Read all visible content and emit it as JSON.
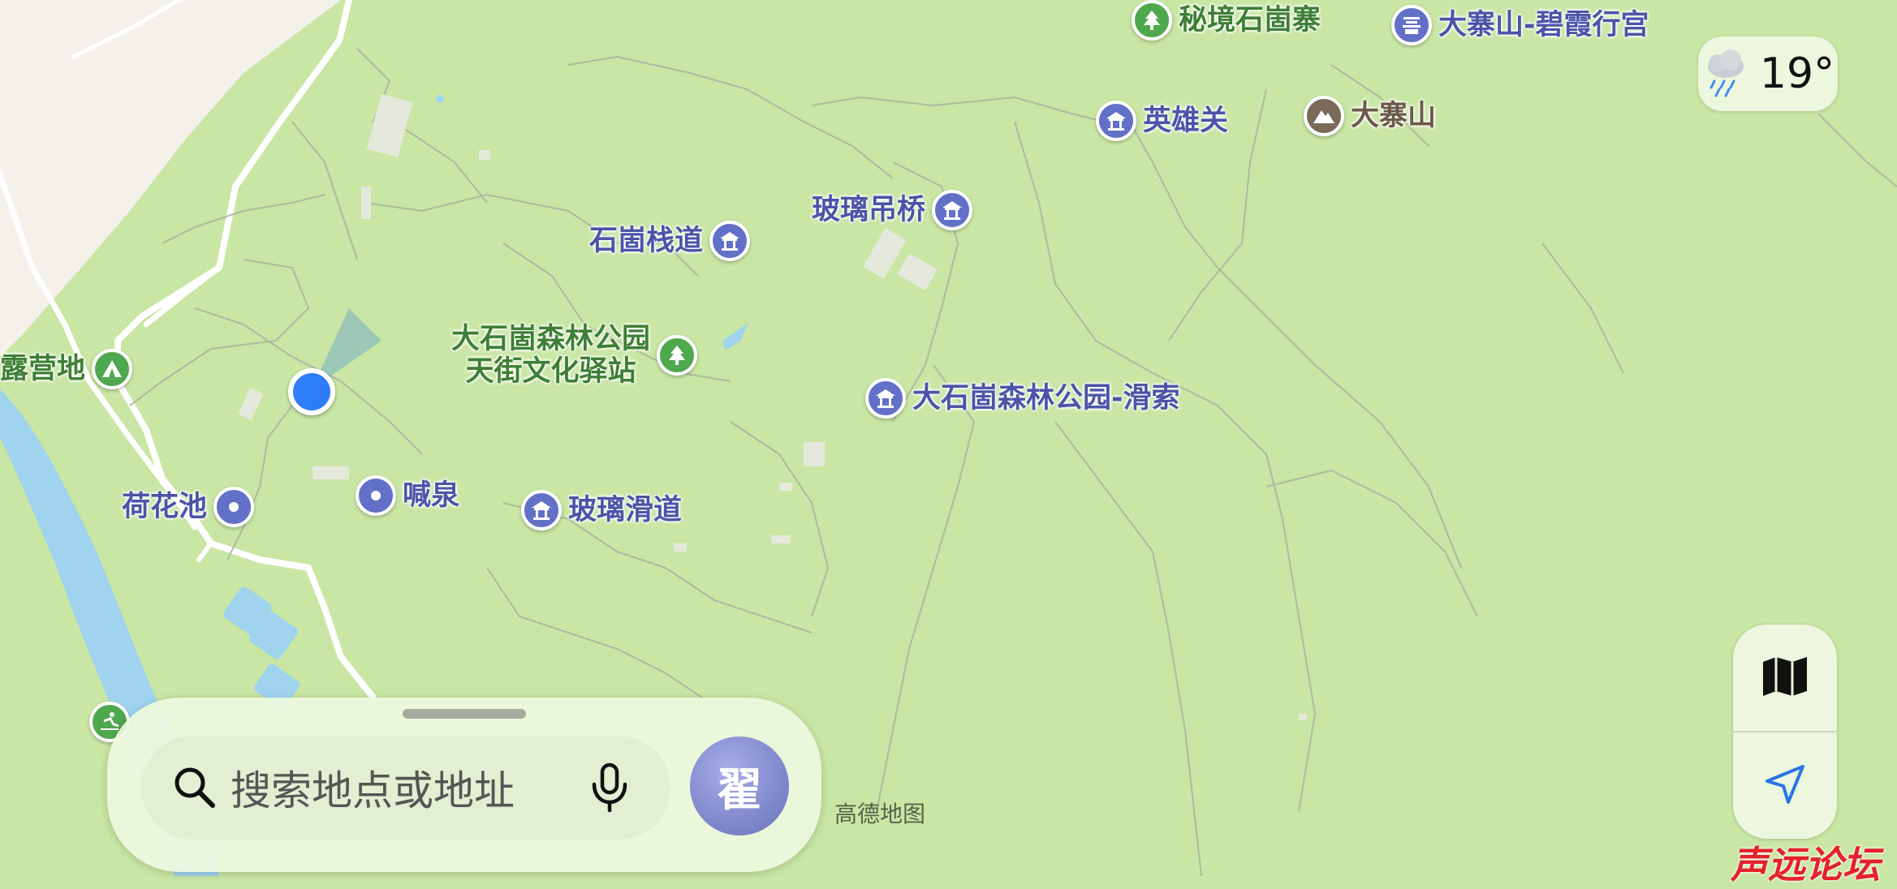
{
  "map": {
    "attribution": "高德地图",
    "pois": [
      {
        "id": "mijing",
        "name": "秘境石崮寨",
        "color": "green",
        "icon": "tree-icon"
      },
      {
        "id": "dazhaishan-bixia",
        "name": "大寨山-碧霞行宫",
        "color": "blue",
        "icon": "temple-icon"
      },
      {
        "id": "yingxiongguan",
        "name": "英雄关",
        "color": "blue",
        "icon": "pavilion-icon"
      },
      {
        "id": "dazhaishan",
        "name": "大寨山",
        "color": "brown",
        "icon": "mountain-icon"
      },
      {
        "id": "boli-diaoqiao",
        "name": "玻璃吊桥",
        "color": "blue",
        "icon": "pavilion-icon"
      },
      {
        "id": "shigu-zhandao",
        "name": "石崮栈道",
        "color": "blue",
        "icon": "pavilion-icon"
      },
      {
        "id": "tianjie-yizhan",
        "name": "大石崮森林公园\n天街文化驿站",
        "color": "green",
        "icon": "tree-icon"
      },
      {
        "id": "huasuo",
        "name": "大石崮森林公园-滑索",
        "color": "blue",
        "icon": "pavilion-icon"
      },
      {
        "id": "luyingdi",
        "name": "露营地",
        "color": "green",
        "icon": "tent-icon"
      },
      {
        "id": "hehuachi",
        "name": "荷花池",
        "color": "blue",
        "icon": "dot-icon"
      },
      {
        "id": "hanquan",
        "name": "喊泉",
        "color": "blue",
        "icon": "dot-icon"
      },
      {
        "id": "boli-huadao",
        "name": "玻璃滑道",
        "color": "blue",
        "icon": "pavilion-icon"
      },
      {
        "id": "unnamed-activity",
        "name": "",
        "color": "green",
        "icon": "activity-icon"
      }
    ]
  },
  "weather": {
    "temperature": "19°",
    "icon": "rain-cloud-icon"
  },
  "controls": {
    "map_mode_icon": "map-icon",
    "locate_icon": "location-arrow-icon"
  },
  "search": {
    "placeholder": "搜索地点或地址",
    "search_icon": "search-icon",
    "mic_icon": "microphone-icon"
  },
  "profile": {
    "avatar_text": "翟"
  },
  "watermark": "声远论坛",
  "colors": {
    "land": "#c9e6a4",
    "urban": "#f4f1ea",
    "water": "#9fd3ee",
    "poi_blue": "#6370c7",
    "poi_green": "#4ea84e",
    "user_location": "#2f7df6"
  }
}
